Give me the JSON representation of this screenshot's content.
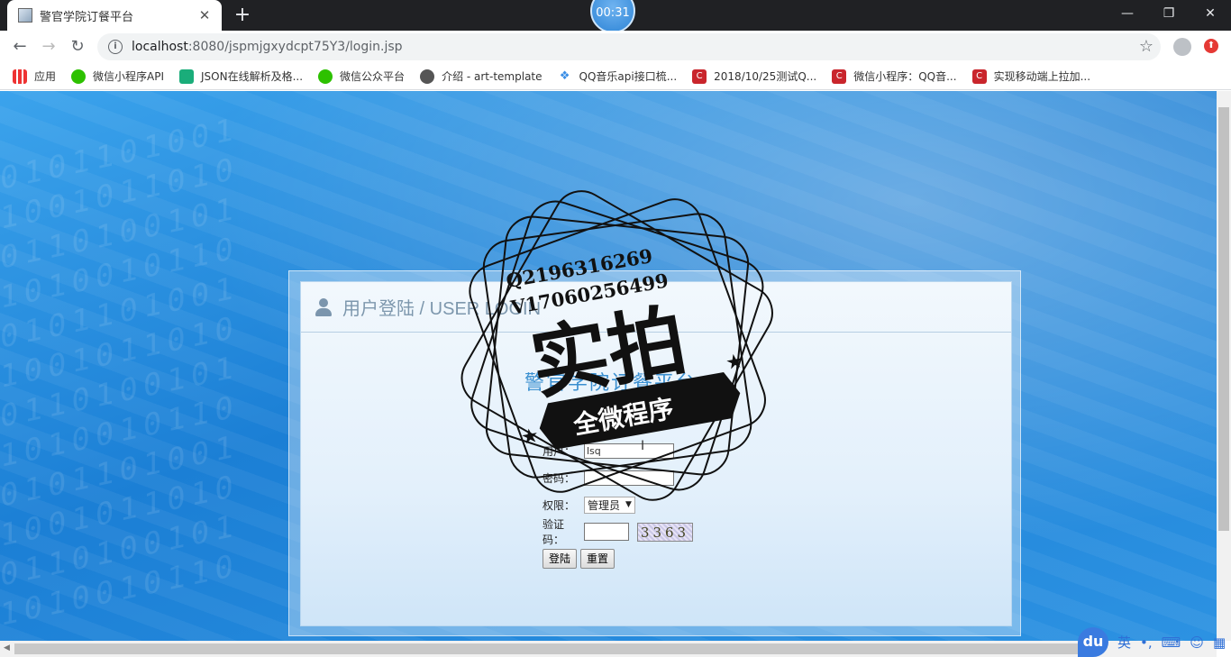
{
  "browser": {
    "tab_title": "警官学院订餐平台",
    "timer": "00:31",
    "url_host": "localhost",
    "url_rest": ":8080/jspmjgxydcpt75Y3/login.jsp"
  },
  "bookmarks": [
    {
      "label": "应用",
      "icon": "apps-icon"
    },
    {
      "label": "微信小程序API",
      "icon": "wechat-icon"
    },
    {
      "label": "JSON在线解析及格...",
      "icon": "json-icon"
    },
    {
      "label": "微信公众平台",
      "icon": "wechat-icon"
    },
    {
      "label": "介绍 - art-template",
      "icon": "globe-icon"
    },
    {
      "label": "QQ音乐api接口梳...",
      "icon": "qq-music-icon"
    },
    {
      "label": "2018/10/25测试Q...",
      "icon": "c-icon"
    },
    {
      "label": "微信小程序：QQ音...",
      "icon": "c-icon"
    },
    {
      "label": "实现移动端上拉加...",
      "icon": "c-icon"
    }
  ],
  "login": {
    "header": "用户登陆 / USER LOGIN",
    "system_title": "警官学院订餐平台",
    "username_label": "用户：",
    "username_value": "lsq",
    "password_label": "密码：",
    "role_label": "权限：",
    "role_value": "管理员",
    "captcha_label": "验证码：",
    "captcha_value": "3363",
    "submit_label": "登陆",
    "reset_label": "重置"
  },
  "watermark": {
    "line1": "Q2196316269",
    "line2": "V17060256499",
    "main": "实拍",
    "ribbon": "全微程序"
  },
  "ime": {
    "brand": "du",
    "lang": "英"
  }
}
